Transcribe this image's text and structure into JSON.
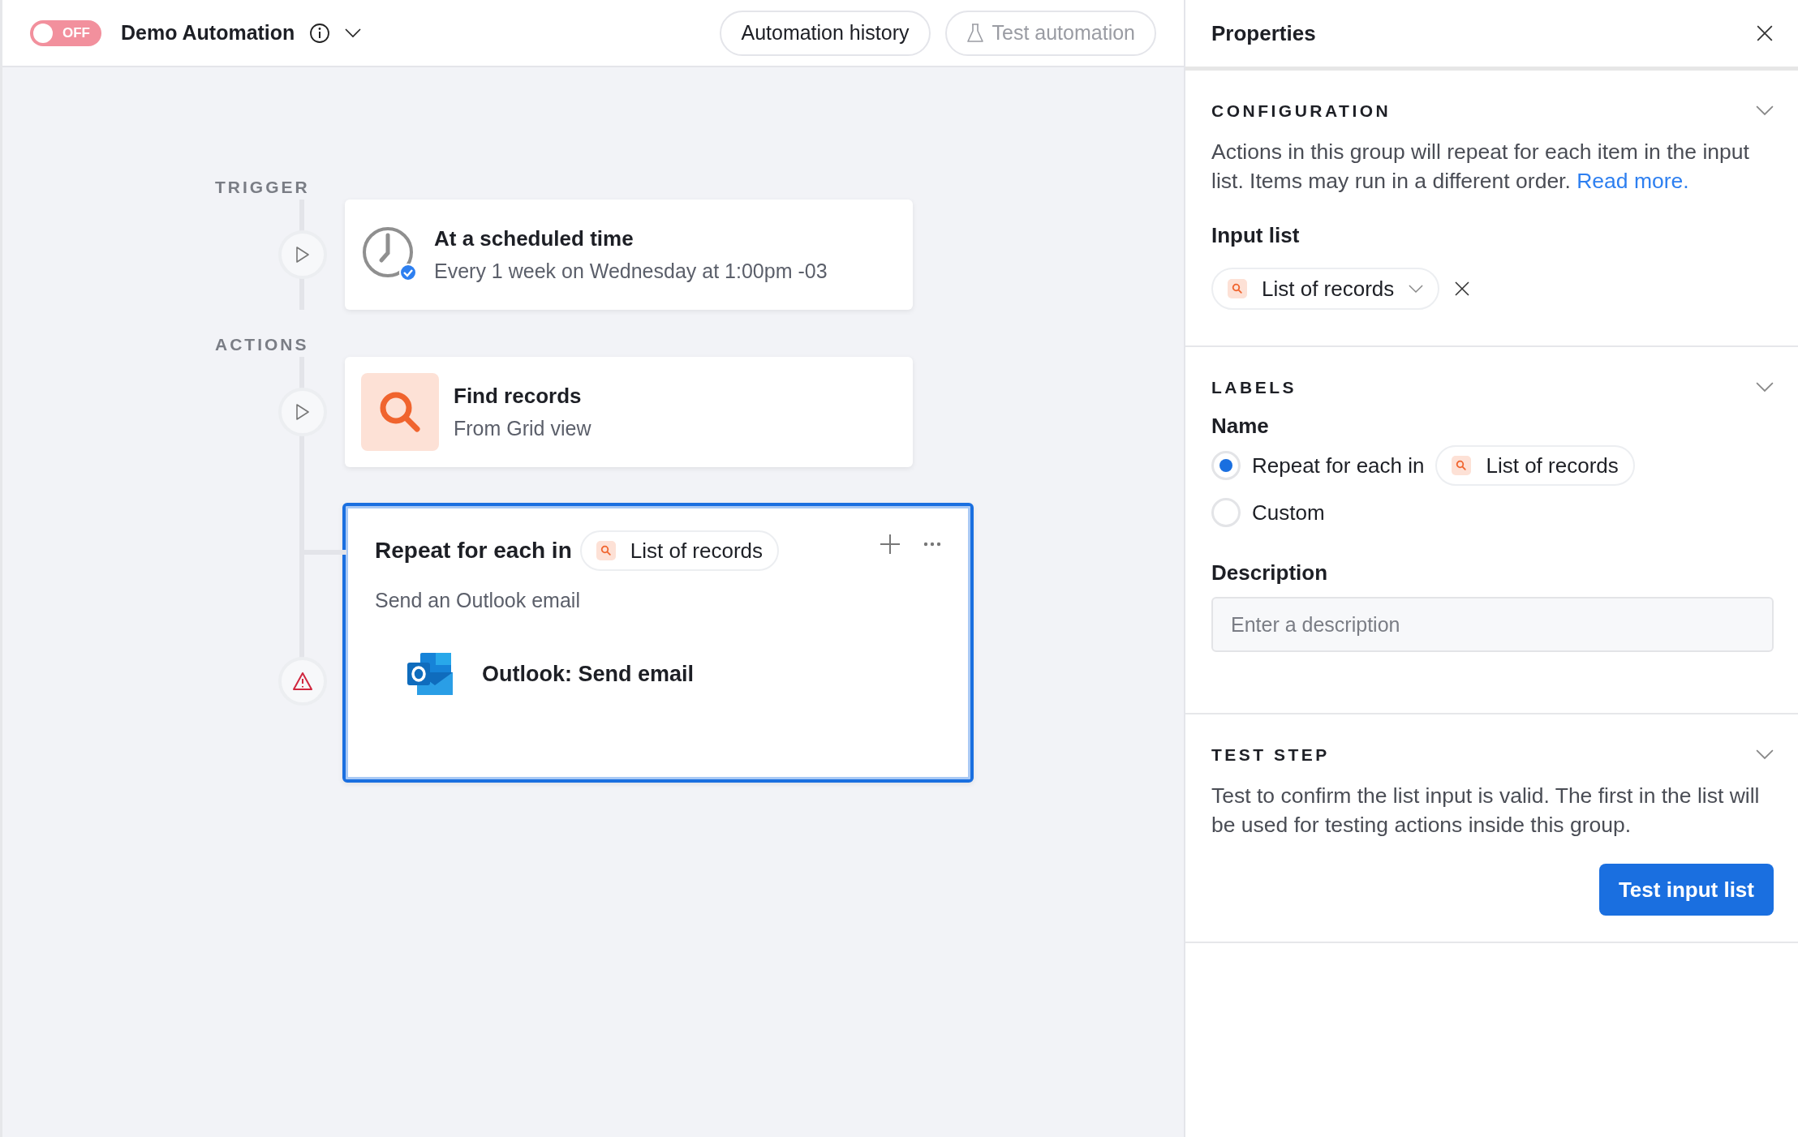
{
  "toolbar": {
    "toggle": {
      "label": "OFF",
      "on": false
    },
    "title": "Demo Automation",
    "buttons": [
      {
        "label": "Automation history",
        "disabled": false,
        "kind": "plain"
      },
      {
        "label": "Test automation",
        "disabled": true,
        "kind": "test"
      }
    ]
  },
  "canvas": {
    "groups": [
      {
        "label": "TRIGGER",
        "steps": [
          {
            "kind": "schedule",
            "warning": false,
            "title": "At a scheduled time",
            "subtitle": "Every 1 week on Wednesday at 1:00pm -03"
          }
        ]
      },
      {
        "label": "ACTIONS",
        "steps": [
          {
            "kind": "find",
            "warning": false,
            "title": "Find records",
            "subtitle": "From Grid view"
          },
          {
            "kind": "repeat",
            "warning": true,
            "selected": true,
            "title": "Repeat for each in",
            "chip": "List of records",
            "subtitle": "Send an Outlook email",
            "inner": {
              "title": "Outlook: Send email"
            }
          }
        ]
      }
    ]
  },
  "properties": {
    "title": "Properties",
    "configuration": {
      "heading": "CONFIGURATION",
      "text": "Actions in this group will repeat for each item in the input list. Items may run in a different order.",
      "link": "Read more.",
      "input_label": "Input list",
      "input_value": "List of records"
    },
    "labels": {
      "heading": "LABELS",
      "name_label": "Name",
      "options": [
        {
          "label": "Repeat for each in",
          "chip": "List of records",
          "selected": true
        },
        {
          "label": "Custom",
          "selected": false
        }
      ],
      "description_label": "Description",
      "description_placeholder": "Enter a description"
    },
    "test_step": {
      "heading": "TEST STEP",
      "text": "Test to confirm the list input is valid. The first in the list will be used for testing actions inside this group.",
      "button": "Test input list"
    }
  }
}
